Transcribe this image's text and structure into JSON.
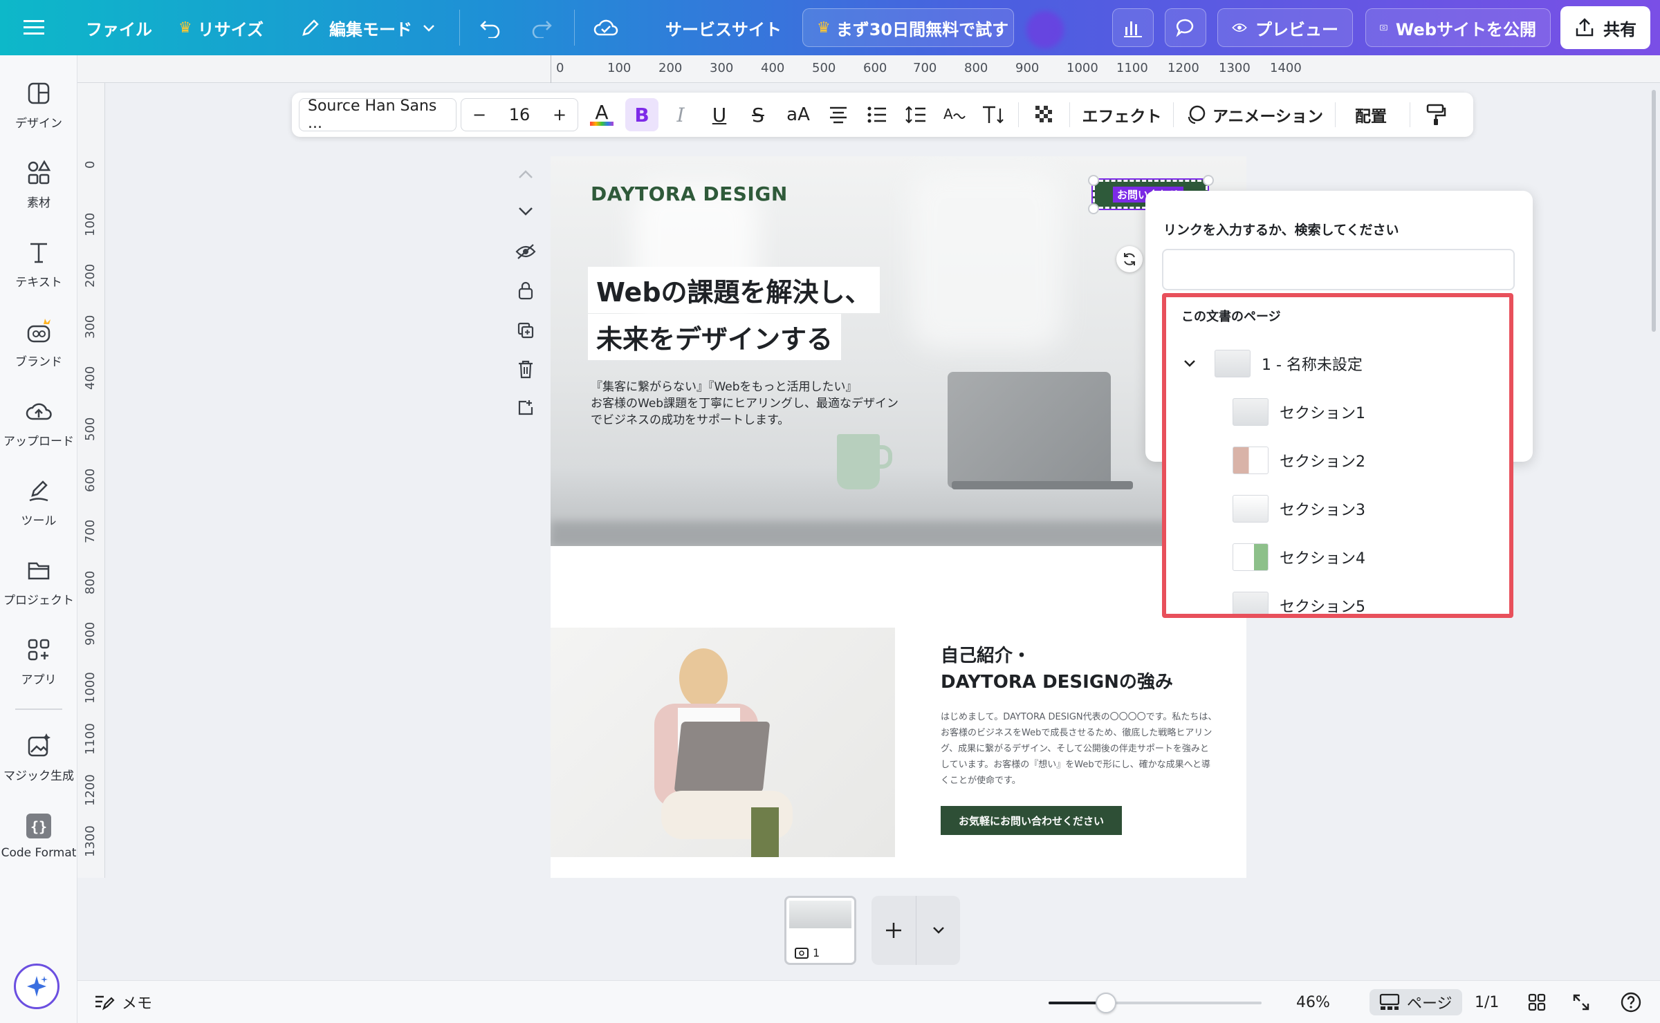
{
  "topbar": {
    "file": "ファイル",
    "resize": "リサイズ",
    "edit_mode": "編集モード",
    "service_site": "サービスサイト",
    "trial": "まず30日間無料で試す",
    "preview": "プレビュー",
    "publish": "Webサイトを公開",
    "share": "共有"
  },
  "sidebar": {
    "items": [
      {
        "label": "デザイン",
        "icon": "layout-icon"
      },
      {
        "label": "素材",
        "icon": "shapes-icon"
      },
      {
        "label": "テキスト",
        "icon": "text-icon"
      },
      {
        "label": "ブランド",
        "icon": "brand-icon"
      },
      {
        "label": "アップロード",
        "icon": "cloud-upload-icon"
      },
      {
        "label": "ツール",
        "icon": "pen-icon"
      },
      {
        "label": "プロジェクト",
        "icon": "folder-icon"
      },
      {
        "label": "アプリ",
        "icon": "apps-icon"
      },
      {
        "label": "マジック生成",
        "icon": "magic-image-icon"
      },
      {
        "label": "Code Format",
        "icon": "code-braces-icon"
      }
    ]
  },
  "ruler": {
    "h": [
      "0",
      "100",
      "200",
      "300",
      "400",
      "500",
      "600",
      "700",
      "800",
      "900",
      "1000",
      "1100",
      "1200",
      "1300",
      "1400"
    ],
    "v": [
      "0",
      "100",
      "200",
      "300",
      "400",
      "500",
      "600",
      "700",
      "800",
      "900",
      "1000",
      "1100",
      "1200",
      "1300"
    ]
  },
  "toolbar": {
    "font": "Source Han Sans ...",
    "minus": "−",
    "font_size": "16",
    "plus": "+",
    "color_a": "A",
    "bold": "B",
    "italic": "I",
    "underline": "U",
    "strike": "S",
    "case": "aA",
    "effects": "エフェクト",
    "animation": "アニメーション",
    "position": "配置"
  },
  "canvas": {
    "brand": "DAYTORA DESIGN",
    "selected_button": "お問い合わせ",
    "hero_line1": "Webの課題を解決し、",
    "hero_line2": "未来をデザインする",
    "hero_p1": "『集客に繋がらない』『Webをもっと活用したい』",
    "hero_p2": "お客様のWeb課題を丁寧にヒアリングし、最適なデザイン",
    "hero_p3": "でビジネスの成功をサポートします。",
    "about_title1": "自己紹介・",
    "about_title2": "DAYTORA DESIGNの強み",
    "about_body": "はじめまして。DAYTORA DESIGN代表の〇〇〇〇です。私たちは、お客様のビジネスをWebで成長させるため、徹底した戦略ヒアリング、成果に繋がるデザイン、そして公開後の伴走サポートを強みとしています。お客様の『想い』をWebで形にし、確かな成果へと導くことが使命です。",
    "about_cta": "お気軽にお問い合わせください"
  },
  "link_popover": {
    "label": "リンクを入力するか、検索してください",
    "input_value": "",
    "section_header": "この文書のページ",
    "page": "1 - 名称未設定",
    "sections": [
      "セクション1",
      "セクション2",
      "セクション3",
      "セクション4",
      "セクション5"
    ]
  },
  "pagestrip": {
    "page_number": "1"
  },
  "statusbar": {
    "memo": "メモ",
    "zoom": "46%",
    "zoom_level": 0.46,
    "page_view": "ページ",
    "page_count": "1/1"
  },
  "colors": {
    "accent_purple": "#7d2ae8",
    "brand_green": "#2f5a3a",
    "highlight_red": "#e8505b"
  }
}
